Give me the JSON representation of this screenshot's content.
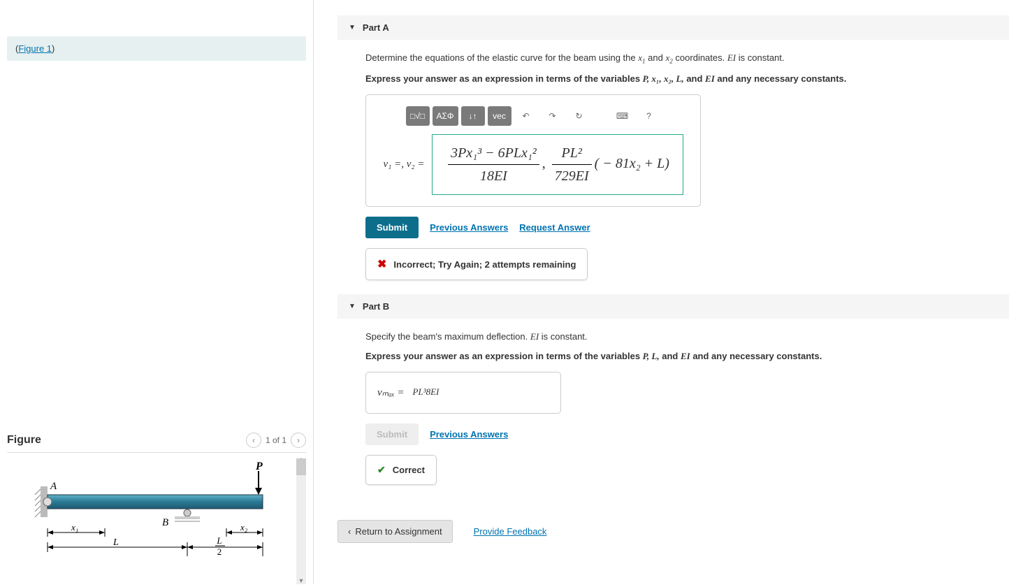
{
  "left": {
    "figure_link": "Figure 1",
    "figure_panel": {
      "title": "Figure",
      "pager": "1 of 1"
    }
  },
  "partA": {
    "title": "Part A",
    "prompt_prefix": "Determine the equations of the elastic curve for the beam using the ",
    "prompt_var1": "x",
    "prompt_sub1": "1",
    "prompt_and": " and ",
    "prompt_var2": "x",
    "prompt_sub2": "2",
    "prompt_suffix": " coordinates. ",
    "prompt_ei": "EI",
    "prompt_const": " is constant.",
    "instruction_prefix": "Express your answer as an expression in terms of the variables ",
    "instruction_vars": "P, x₁, x₂, L,",
    "instruction_and": " and ",
    "instruction_ei": "EI",
    "instruction_suffix": " and any necessary constants.",
    "toolbar": {
      "templates": "□√□",
      "greek": "ΑΣΦ",
      "subsup": "↓↑",
      "vec": "vec",
      "undo": "↶",
      "redo": "↷",
      "reset": "↻",
      "keyboard": "⌨",
      "help": "?"
    },
    "lhs": "v₁ =,  v₂ =",
    "answer_num": "3Px₁³ − 6PLx₁²",
    "answer_den1": "18EI",
    "answer_sep": ", ",
    "answer_num2": "PL²",
    "answer_den2": "729EI",
    "answer_tail": "( − 81x₂ + L)",
    "submit": "Submit",
    "prev_answers": "Previous Answers",
    "request_answer": "Request Answer",
    "feedback": "Incorrect; Try Again; 2 attempts remaining"
  },
  "partB": {
    "title": "Part B",
    "prompt_prefix": "Specify the beam's maximum deflection. ",
    "prompt_ei": "EI",
    "prompt_const": " is constant.",
    "instruction_prefix": "Express your answer as an expression in terms of the variables ",
    "instruction_vars": "P, L,",
    "instruction_and": " and ",
    "instruction_ei": "EI",
    "instruction_suffix": " and any necessary constants.",
    "lhs": "vₘₐₓ =",
    "answer_num": "PL³",
    "answer_den": "8EI",
    "submit": "Submit",
    "prev_answers": "Previous Answers",
    "feedback": "Correct"
  },
  "footer": {
    "return": "Return to Assignment",
    "feedback": "Provide Feedback"
  },
  "diagram": {
    "labels": {
      "P": "P",
      "A": "A",
      "B": "B",
      "x1": "x₁",
      "x2": "x₂",
      "L": "L",
      "Lhalf_num": "L",
      "Lhalf_den": "2"
    }
  }
}
